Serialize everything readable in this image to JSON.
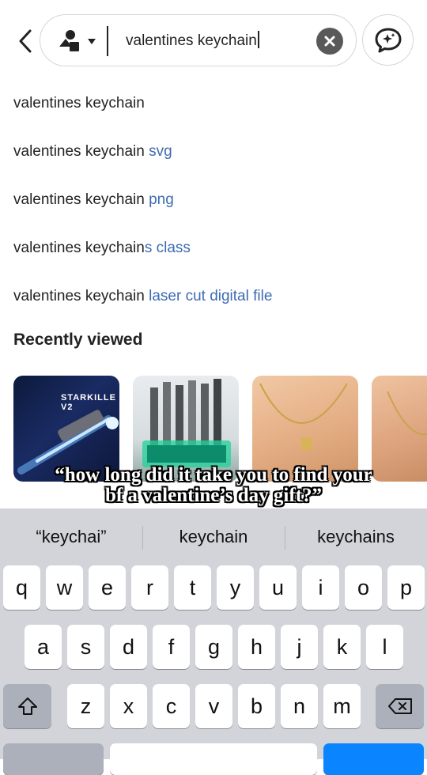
{
  "search": {
    "query": "valentines keychain"
  },
  "suggestions": [
    {
      "base": "valentines keychain",
      "completion": ""
    },
    {
      "base": "valentines keychain ",
      "completion": "svg"
    },
    {
      "base": "valentines keychain ",
      "completion": "png"
    },
    {
      "base": "valentines keychain",
      "completion": "s class"
    },
    {
      "base": "valentines keychain ",
      "completion": "laser cut digital file"
    }
  ],
  "recently_viewed": {
    "title": "Recently viewed",
    "items": [
      {
        "label_line1": "STARKILLE",
        "label_line2": "V2"
      },
      {
        "label_line1": "",
        "label_line2": ""
      },
      {
        "label_line1": "",
        "label_line2": ""
      },
      {
        "label_line1": "",
        "label_line2": ""
      }
    ]
  },
  "caption": {
    "text": "“how long did it take you to find your bf a valentine’s day gift?”"
  },
  "keyboard": {
    "predictions": [
      "“keychai”",
      "keychain",
      "keychains"
    ],
    "row1": [
      "q",
      "w",
      "e",
      "r",
      "t",
      "y",
      "u",
      "i",
      "o",
      "p"
    ],
    "row2": [
      "a",
      "s",
      "d",
      "f",
      "g",
      "h",
      "j",
      "k",
      "l"
    ],
    "row3": [
      "z",
      "x",
      "c",
      "v",
      "b",
      "n",
      "m"
    ]
  },
  "colors": {
    "accent_blue": "#3d6bb3",
    "keyboard_bg": "#d2d4da"
  }
}
